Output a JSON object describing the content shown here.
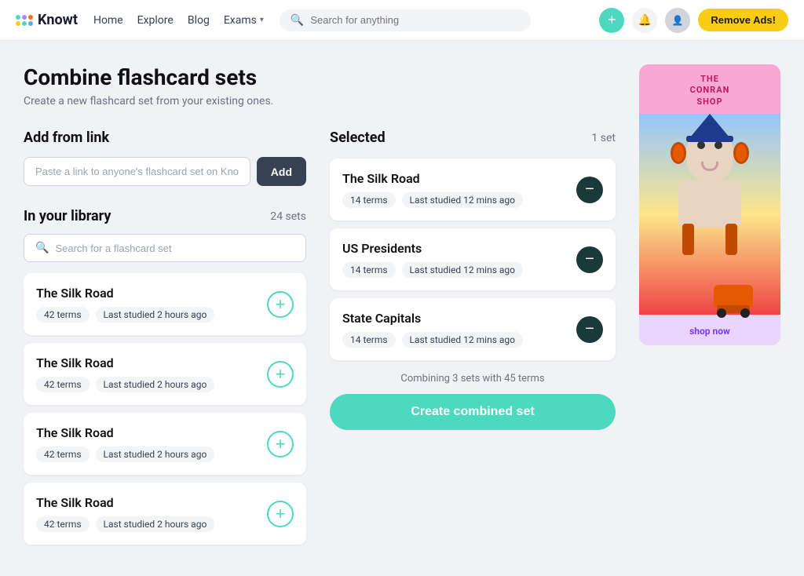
{
  "nav": {
    "logo_text": "Knowt",
    "links": [
      "Home",
      "Explore",
      "Blog"
    ],
    "exams_label": "Exams",
    "search_placeholder": "Search for anything",
    "remove_ads_label": "Remove Ads!"
  },
  "page": {
    "title": "Combine flashcard sets",
    "subtitle": "Create a new flashcard set from your existing ones.",
    "add_from_link_label": "Add from link",
    "link_placeholder": "Paste a link to anyone's flashcard set on Knowt",
    "add_btn_label": "Add",
    "library_label": "In your library",
    "library_count": "24 sets",
    "library_search_placeholder": "Search for a flashcard set"
  },
  "library_items": [
    {
      "title": "The Silk Road",
      "terms": "42 terms",
      "last_studied": "Last studied 2 hours ago"
    },
    {
      "title": "The Silk Road",
      "terms": "42 terms",
      "last_studied": "Last studied 2 hours ago"
    },
    {
      "title": "The Silk Road",
      "terms": "42 terms",
      "last_studied": "Last studied 2 hours ago"
    },
    {
      "title": "The Silk Road",
      "terms": "42 terms",
      "last_studied": "Last studied 2 hours ago"
    }
  ],
  "selected": {
    "label": "Selected",
    "count": "1 set",
    "combine_info": "Combining 3 sets with 45 terms",
    "create_btn_label": "Create combined set",
    "items": [
      {
        "title": "The Silk Road",
        "terms": "14 terms",
        "last_studied": "Last studied 12 mins ago"
      },
      {
        "title": "US Presidents",
        "terms": "14 terms",
        "last_studied": "Last studied 12 mins ago"
      },
      {
        "title": "State Capitals",
        "terms": "14 terms",
        "last_studied": "Last studied 12 mins ago"
      }
    ]
  },
  "ad": {
    "top_text": "THE\nCONRAN\nSHOP",
    "shop_now_label": "shop now"
  }
}
